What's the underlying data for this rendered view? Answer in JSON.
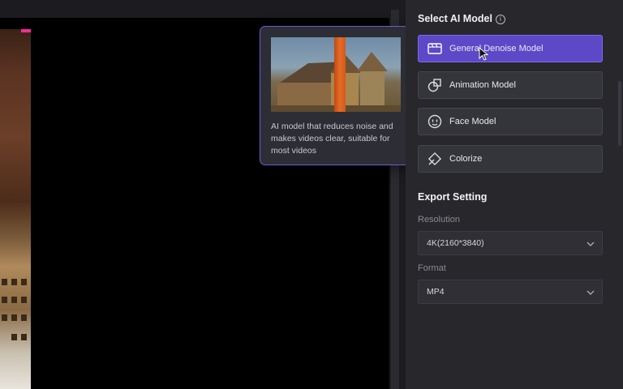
{
  "tooltip": {
    "description": "AI model that reduces noise and makes videos clear, suitable for most videos"
  },
  "ai_model": {
    "title": "Select AI Model",
    "info_icon": "info-icon",
    "models": [
      {
        "label": "General Denoise Model",
        "icon": "film-icon",
        "active": true
      },
      {
        "label": "Animation Model",
        "icon": "animation-shapes-icon",
        "active": false
      },
      {
        "label": "Face Model",
        "icon": "face-icon",
        "active": false
      },
      {
        "label": "Colorize",
        "icon": "colorize-icon",
        "active": false
      }
    ]
  },
  "export": {
    "title": "Export Setting",
    "resolution_label": "Resolution",
    "resolution_value": "4K(2160*3840)",
    "format_label": "Format",
    "format_value": "MP4"
  },
  "colors": {
    "accent": "#5d49c7",
    "panel_bg": "#27272c",
    "tooltip_border": "#6a5cd8"
  }
}
